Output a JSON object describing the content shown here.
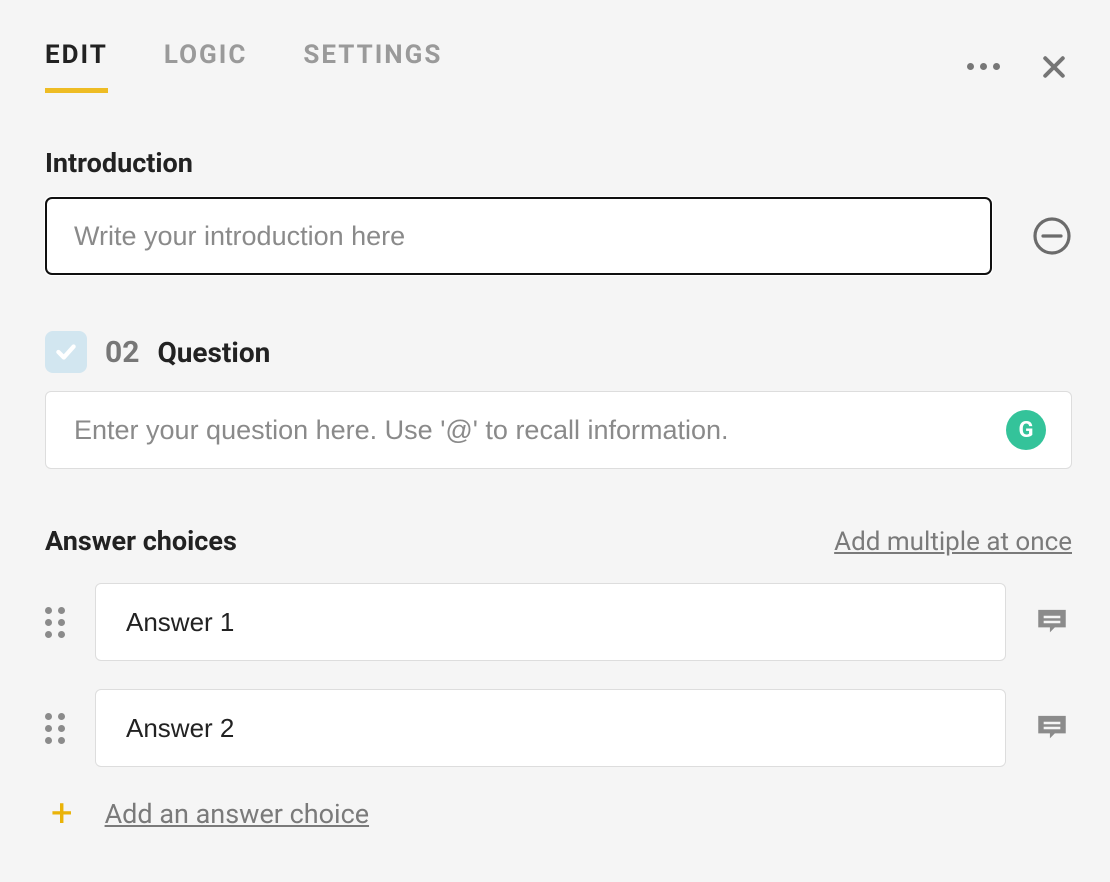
{
  "tabs": {
    "edit": "EDIT",
    "logic": "LOGIC",
    "settings": "SETTINGS",
    "active": "edit"
  },
  "intro": {
    "label": "Introduction",
    "placeholder": "Write your introduction here"
  },
  "question": {
    "number": "02",
    "title": "Question",
    "placeholder": "Enter your question here. Use '@' to recall information.",
    "grammarly_glyph": "G"
  },
  "answers": {
    "title": "Answer choices",
    "add_multiple": "Add multiple at once",
    "items": [
      {
        "value": "Answer 1"
      },
      {
        "value": "Answer 2"
      }
    ],
    "add_label": "Add an answer choice"
  }
}
